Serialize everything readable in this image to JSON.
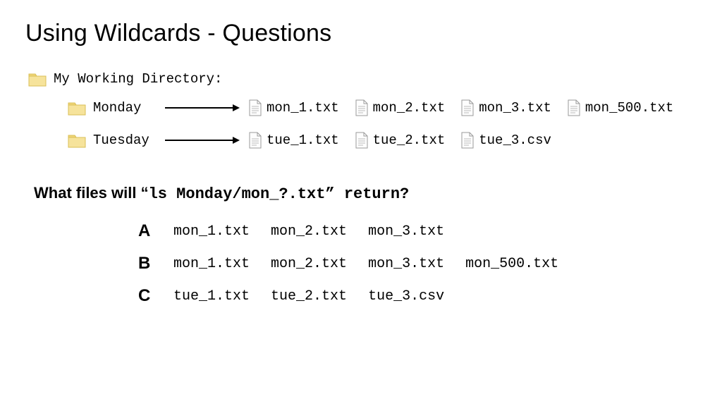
{
  "title": "Using Wildcards - Questions",
  "directory": {
    "label": "My Working Directory:",
    "folders": [
      {
        "name": "Monday",
        "files": [
          "mon_1.txt",
          "mon_2.txt",
          "mon_3.txt",
          "mon_500.txt"
        ]
      },
      {
        "name": "Tuesday",
        "files": [
          "tue_1.txt",
          "tue_2.txt",
          "tue_3.csv"
        ]
      }
    ]
  },
  "question": {
    "prefix": "What files will “",
    "command": "ls Monday/mon_?.txt",
    "suffix": "” return?"
  },
  "answers": [
    {
      "label": "A",
      "files": [
        "mon_1.txt",
        "mon_2.txt",
        "mon_3.txt"
      ]
    },
    {
      "label": "B",
      "files": [
        "mon_1.txt",
        "mon_2.txt",
        "mon_3.txt",
        "mon_500.txt"
      ]
    },
    {
      "label": "C",
      "files": [
        "tue_1.txt",
        "tue_2.txt",
        "tue_3.csv"
      ]
    }
  ]
}
